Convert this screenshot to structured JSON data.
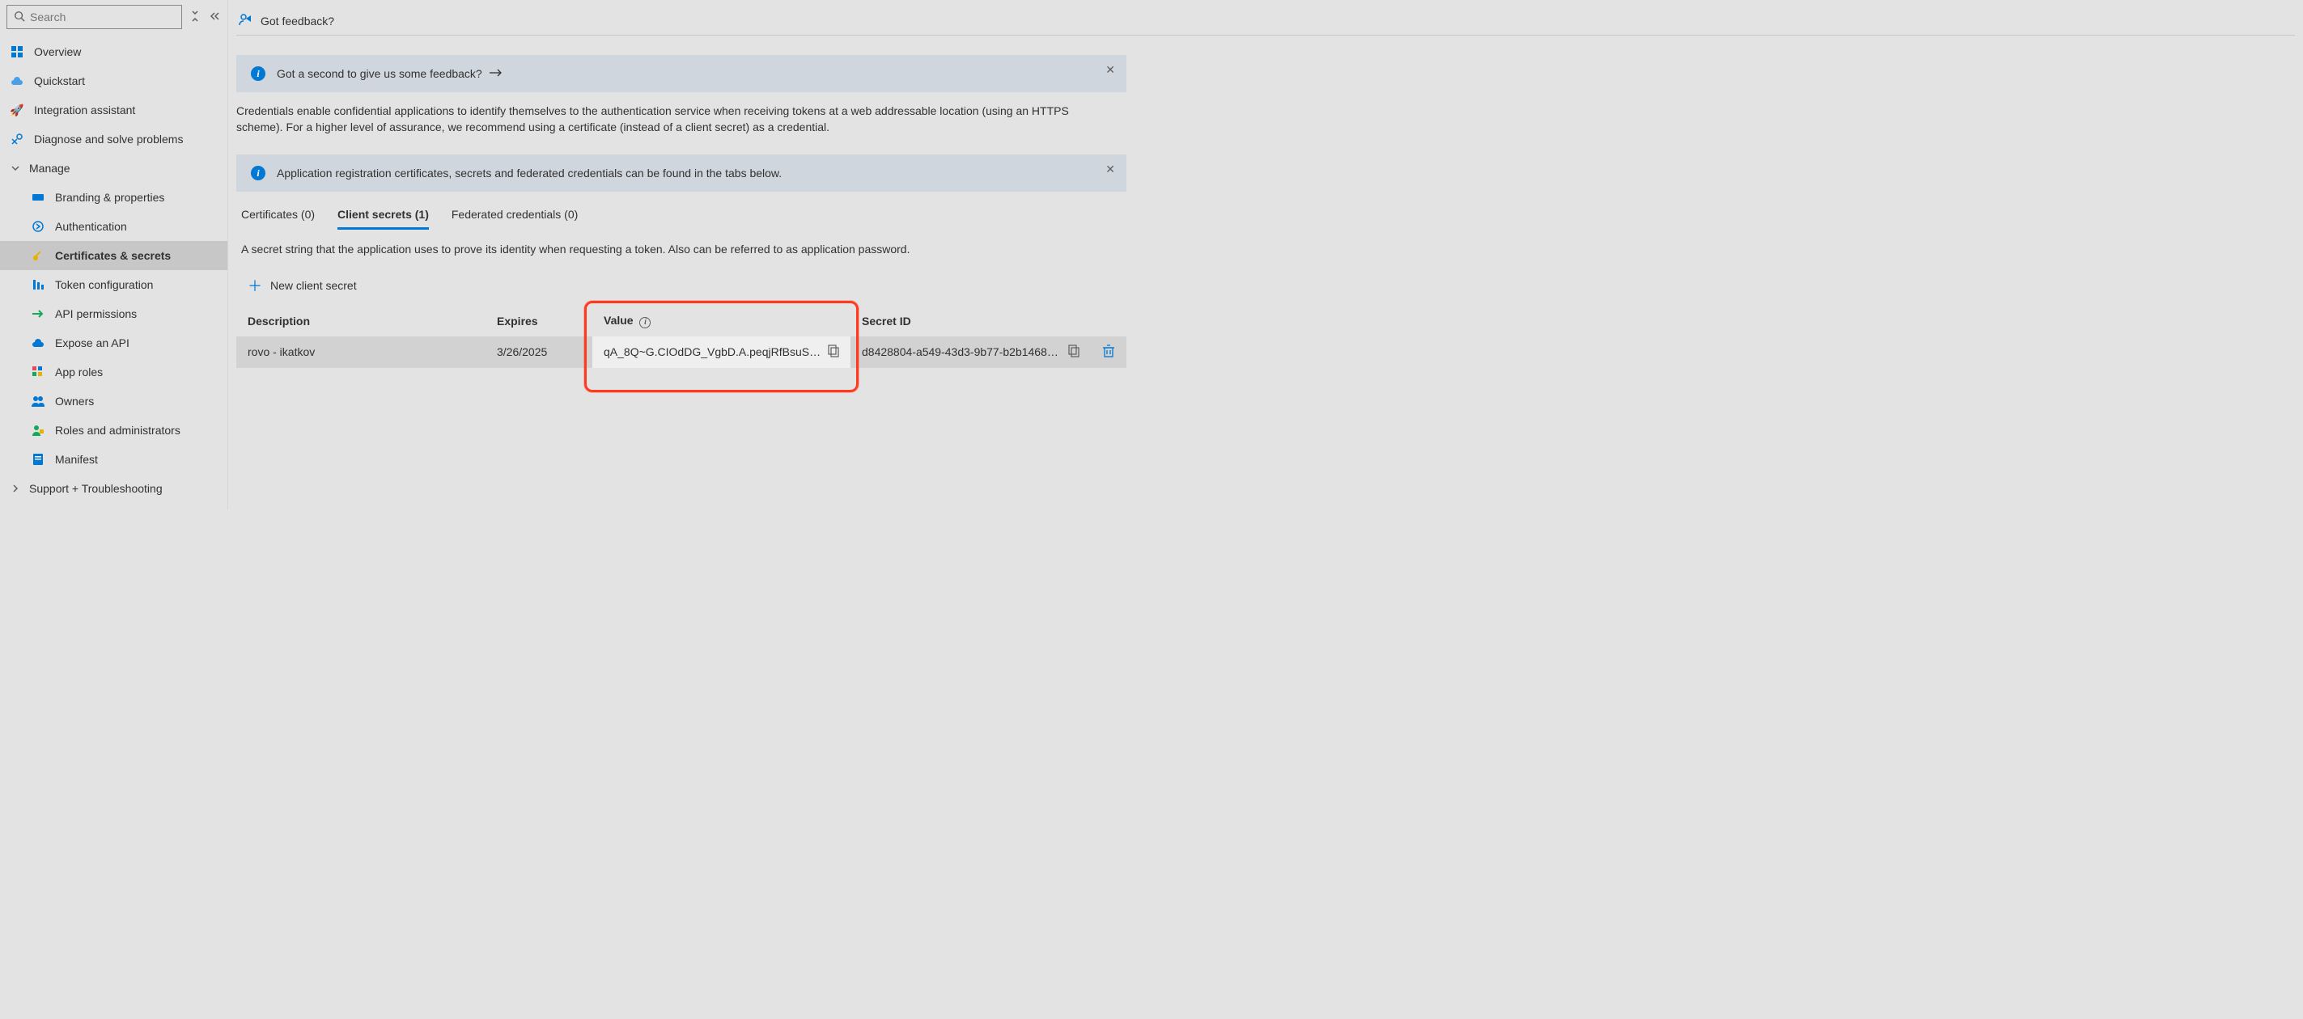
{
  "search": {
    "placeholder": "Search"
  },
  "sidebar": {
    "overview": "Overview",
    "quickstart": "Quickstart",
    "integration": "Integration assistant",
    "diagnose": "Diagnose and solve problems",
    "manage_header": "Manage",
    "branding": "Branding & properties",
    "authentication": "Authentication",
    "certs": "Certificates & secrets",
    "token": "Token configuration",
    "api_perm": "API permissions",
    "expose": "Expose an API",
    "approles": "App roles",
    "owners": "Owners",
    "roles": "Roles and administrators",
    "manifest": "Manifest",
    "support_header": "Support + Troubleshooting"
  },
  "toolbar": {
    "feedback": "Got feedback?"
  },
  "banners": {
    "feedback_prompt": "Got a second to give us some feedback?",
    "tabs_info": "Application registration certificates, secrets and federated credentials can be found in the tabs below."
  },
  "description": "Credentials enable confidential applications to identify themselves to the authentication service when receiving tokens at a web addressable location (using an HTTPS scheme). For a higher level of assurance, we recommend using a certificate (instead of a client secret) as a credential.",
  "tabs": {
    "certs": "Certificates (0)",
    "secrets": "Client secrets (1)",
    "federated": "Federated credentials (0)"
  },
  "secrets_tab": {
    "description": "A secret string that the application uses to prove its identity when requesting a token. Also can be referred to as application password.",
    "new_button": "New client secret",
    "columns": {
      "desc": "Description",
      "expires": "Expires",
      "value": "Value",
      "secret_id": "Secret ID"
    },
    "rows": [
      {
        "desc": "rovo - ikatkov",
        "expires": "3/26/2025",
        "value": "qA_8Q~G.CIOdDG_VgbD.A.peqjRfBsuS1I...",
        "secret_id": "d8428804-a549-43d3-9b77-b2b146873c..."
      }
    ]
  }
}
